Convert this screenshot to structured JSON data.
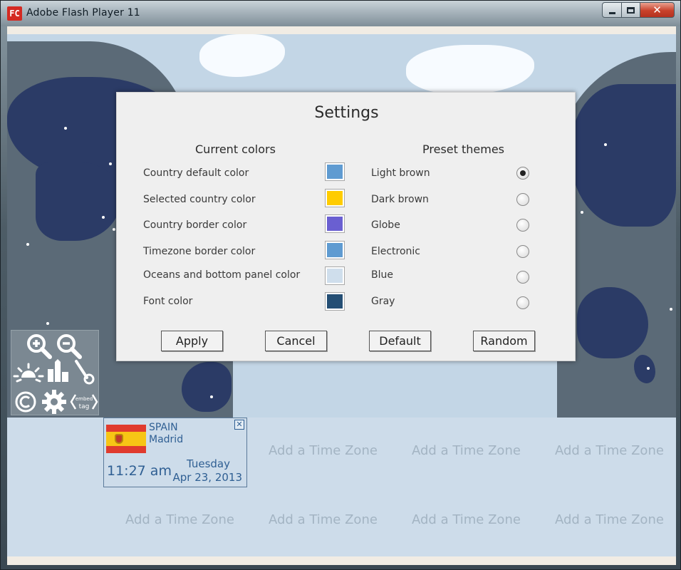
{
  "window": {
    "title": "Adobe Flash Player 11",
    "icon_text": "FC"
  },
  "settings": {
    "title": "Settings",
    "current_colors_heading": "Current colors",
    "preset_themes_heading": "Preset themes",
    "colors": [
      {
        "label": "Country default color",
        "color": "#5f9bd1"
      },
      {
        "label": "Selected country color",
        "color": "#ffcc00"
      },
      {
        "label": "Country border color",
        "color": "#6a5fd1"
      },
      {
        "label": "Timezone border color",
        "color": "#5f9bd1"
      },
      {
        "label": "Oceans and bottom panel color",
        "color": "#cfdeec"
      },
      {
        "label": "Font color",
        "color": "#244e74"
      }
    ],
    "themes": [
      {
        "label": "Light brown",
        "selected": true
      },
      {
        "label": "Dark brown",
        "selected": false
      },
      {
        "label": "Globe",
        "selected": false
      },
      {
        "label": "Electronic",
        "selected": false
      },
      {
        "label": "Blue",
        "selected": false
      },
      {
        "label": "Gray",
        "selected": false
      }
    ],
    "buttons": {
      "apply": "Apply",
      "cancel": "Cancel",
      "default": "Default",
      "random": "Random"
    }
  },
  "toolbar": {
    "icons": [
      "zoom-in-icon",
      "zoom-out-icon",
      "sun-icon",
      "city-icon",
      "pin-icon",
      "copyright-icon",
      "gear-icon",
      "embed-tag-icon"
    ],
    "embed_label_top": "embed",
    "embed_label_bottom": "tag"
  },
  "timezone_card": {
    "country": "SPAIN",
    "city": "Madrid",
    "time": "11:27 am",
    "day": "Tuesday",
    "date": "Apr 23, 2013",
    "close_glyph": "✕"
  },
  "add_time_zone_slots": [
    "Add a Time Zone",
    "Add a Time Zone",
    "Add a Time Zone",
    "Add a Time Zone",
    "Add a Time Zone",
    "Add a Time Zone",
    "Add a Time Zone"
  ],
  "colors": {
    "ocean": "#c3d6e6",
    "land": "#2b3b66",
    "night": "#5b6a77",
    "panel": "#cddcea",
    "card_text": "#2f5f93"
  }
}
